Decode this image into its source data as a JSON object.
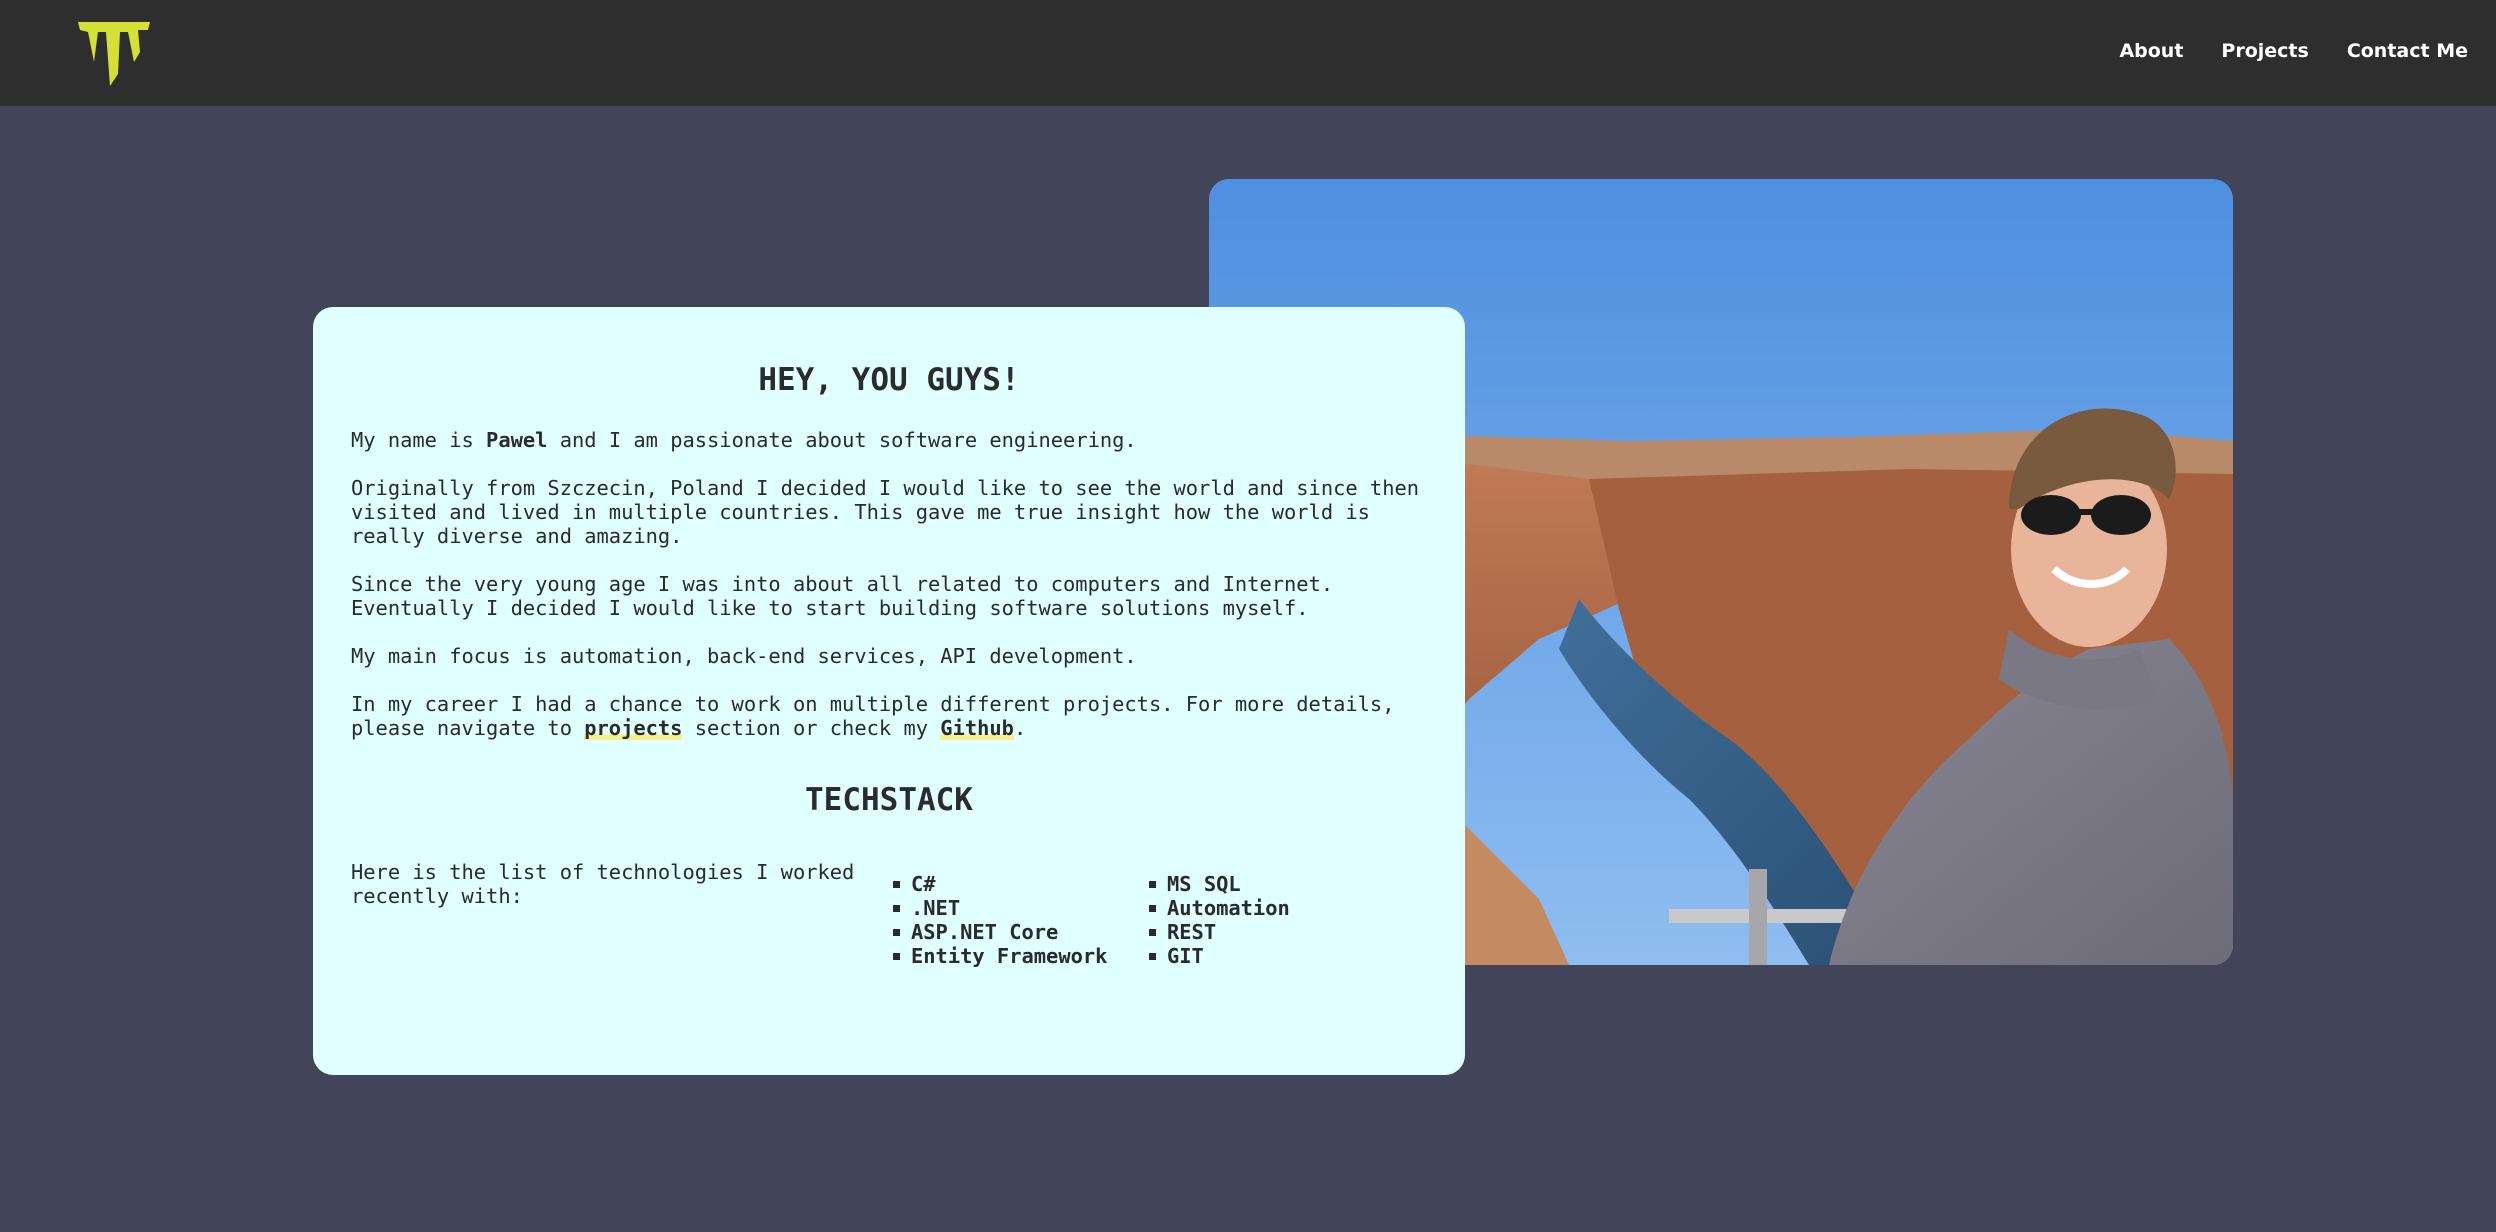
{
  "nav": {
    "logo_icon": "tp-monogram-logo",
    "links": [
      "About",
      "Projects",
      "Contact Me"
    ]
  },
  "about": {
    "title": "HEY, YOU GUYS!",
    "intro_prefix": "My name is ",
    "intro_name": "Pawel",
    "intro_suffix": " and I am passionate about software engineering.",
    "para2": "Originally from Szczecin, Poland I decided I would like to see the world and since then visited and lived in multiple countries. This gave me true insight how the world is really diverse and amazing.",
    "para3": "Since the very young age I was into about all related to computers and Internet. Eventually I decided I would like to start building software solutions myself.",
    "para4": "My main focus is automation, back-end services, API development.",
    "para5_prefix": "In my career I had a chance to work on multiple different projects. For more details, please navigate to ",
    "projects_link": "projects",
    "para5_middle": " section or check my ",
    "github_link": "Github",
    "para5_suffix": "."
  },
  "techstack": {
    "title": "TECHSTACK",
    "intro": "Here is the list of technologies I worked recently with:",
    "column1": [
      "C#",
      ".NET",
      "ASP.NET Core",
      "Entity Framework"
    ],
    "column2": [
      "MS SQL",
      "Automation",
      "REST",
      "GIT"
    ]
  },
  "photo": {
    "description_icon": "profile-photo"
  },
  "colors": {
    "background": "#42455a",
    "navbar": "#2e2e2e",
    "card": "#e0ffff",
    "logo": "#d4e033",
    "link_highlight": "#f5f08a"
  }
}
